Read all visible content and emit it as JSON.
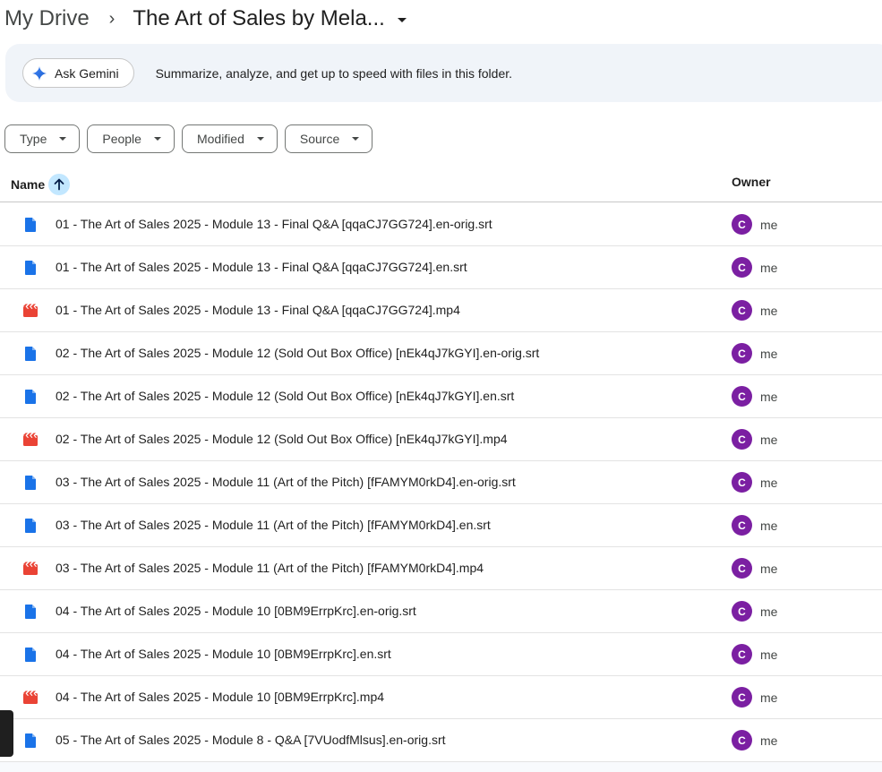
{
  "breadcrumb": {
    "root": "My Drive",
    "separator": "›",
    "current": "The Art of Sales by Mela..."
  },
  "gemini": {
    "button_label": "Ask Gemini",
    "description": "Summarize, analyze, and get up to speed with files in this folder."
  },
  "filters": [
    {
      "label": "Type"
    },
    {
      "label": "People"
    },
    {
      "label": "Modified"
    },
    {
      "label": "Source"
    }
  ],
  "table": {
    "col_name": "Name",
    "col_owner": "Owner",
    "sort": "ascending",
    "rows": [
      {
        "name": "01 - The Art of Sales 2025 - Module 13 - Final Q&A [qqaCJ7GG724].en-orig.srt",
        "type": "doc",
        "owner": "me",
        "avatar": "C"
      },
      {
        "name": "01 - The Art of Sales 2025 - Module 13 - Final Q&A [qqaCJ7GG724].en.srt",
        "type": "doc",
        "owner": "me",
        "avatar": "C"
      },
      {
        "name": "01 - The Art of Sales 2025 - Module 13 - Final Q&A [qqaCJ7GG724].mp4",
        "type": "video",
        "owner": "me",
        "avatar": "C"
      },
      {
        "name": "02 - The Art of Sales 2025 - Module 12 (Sold Out Box Office) [nEk4qJ7kGYI].en-orig.srt",
        "type": "doc",
        "owner": "me",
        "avatar": "C"
      },
      {
        "name": "02 - The Art of Sales 2025 - Module 12 (Sold Out Box Office) [nEk4qJ7kGYI].en.srt",
        "type": "doc",
        "owner": "me",
        "avatar": "C"
      },
      {
        "name": "02 - The Art of Sales 2025 - Module 12 (Sold Out Box Office) [nEk4qJ7kGYI].mp4",
        "type": "video",
        "owner": "me",
        "avatar": "C"
      },
      {
        "name": "03 - The Art of Sales 2025 - Module 11 (Art of the Pitch) [fFAMYM0rkD4].en-orig.srt",
        "type": "doc",
        "owner": "me",
        "avatar": "C"
      },
      {
        "name": "03 - The Art of Sales 2025 - Module 11 (Art of the Pitch) [fFAMYM0rkD4].en.srt",
        "type": "doc",
        "owner": "me",
        "avatar": "C"
      },
      {
        "name": "03 - The Art of Sales 2025 - Module 11 (Art of the Pitch) [fFAMYM0rkD4].mp4",
        "type": "video",
        "owner": "me",
        "avatar": "C"
      },
      {
        "name": "04 - The Art of Sales 2025 - Module 10 [0BM9ErrpKrc].en-orig.srt",
        "type": "doc",
        "owner": "me",
        "avatar": "C"
      },
      {
        "name": "04 - The Art of Sales 2025 - Module 10 [0BM9ErrpKrc].en.srt",
        "type": "doc",
        "owner": "me",
        "avatar": "C"
      },
      {
        "name": "04 - The Art of Sales 2025 - Module 10 [0BM9ErrpKrc].mp4",
        "type": "video",
        "owner": "me",
        "avatar": "C"
      },
      {
        "name": "05 - The Art of Sales 2025 - Module 8 - Q&A [7VUodfMlsus].en-orig.srt",
        "type": "doc",
        "owner": "me",
        "avatar": "C"
      }
    ]
  },
  "colors": {
    "doc_icon": "#1a73e8",
    "video_icon": "#ea4335",
    "avatar_bg": "#7b1fa2",
    "sort_badge": "#c2e7ff",
    "gemini_bar": "#f0f4f9"
  },
  "icons": {
    "sort": "arrow-up-icon",
    "gemini": "gemini-sparkle-icon",
    "doc": "document-icon",
    "video": "video-icon"
  }
}
